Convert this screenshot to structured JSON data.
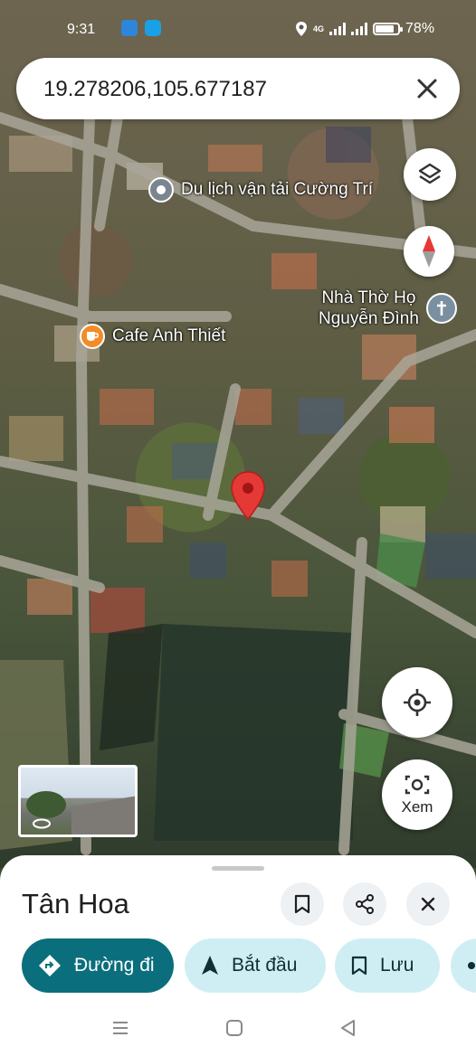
{
  "status_bar": {
    "time": "9:31",
    "network": "4G",
    "battery_percent": "78%",
    "battery_level": 0.78
  },
  "search": {
    "query": "19.278206,105.677187",
    "clear_icon": "close-icon"
  },
  "map": {
    "pois": [
      {
        "name": "Du lịch vận tải Cường Trí",
        "icon": "place-pin-icon"
      },
      {
        "name": "Cafe Anh Thiết",
        "icon": "coffee-cup-icon",
        "color": "#f28c28"
      },
      {
        "name_line1": "Nhà Thờ Họ",
        "name_line2": "Nguyễn Đình",
        "icon": "cross-icon",
        "color": "#7a8fa0"
      }
    ],
    "marker_color": "#e53935"
  },
  "controls": {
    "layers_icon": "layers-icon",
    "compass_icon": "compass-icon",
    "locate_icon": "my-location-icon",
    "lens_label": "Xem",
    "lens_icon": "camera-lens-icon"
  },
  "sheet": {
    "title": "Tân Hoa",
    "actions": [
      {
        "name": "save",
        "icon": "bookmark-icon"
      },
      {
        "name": "share",
        "icon": "share-icon"
      },
      {
        "name": "close",
        "icon": "close-icon"
      }
    ],
    "chips": [
      {
        "label": "Đường đi",
        "icon": "directions-icon"
      },
      {
        "label": "Bắt đầu",
        "icon": "navigation-arrow-icon"
      },
      {
        "label": "Lưu",
        "icon": "bookmark-icon"
      }
    ],
    "accent": "#0b6e7c",
    "chip_secondary_bg": "#cfeef3"
  },
  "system_nav": [
    {
      "name": "recent-apps",
      "icon": "menu-lines-icon"
    },
    {
      "name": "home",
      "icon": "square-icon"
    },
    {
      "name": "back",
      "icon": "triangle-back-icon"
    }
  ]
}
